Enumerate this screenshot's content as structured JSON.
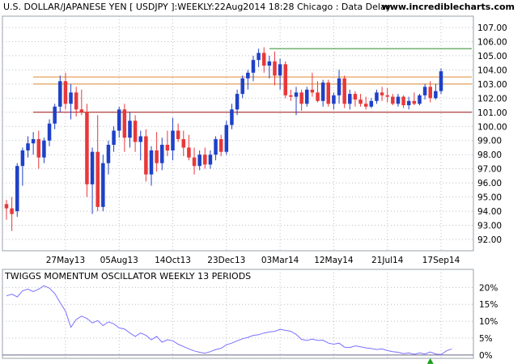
{
  "header": {
    "instrument": "U.S. DOLLAR/JAPANESE YEN [ USDJPY ]:WEEKLY:22Aug2014 18:28 Chicago : Data Delaye...",
    "site": "www.incrediblecharts.com"
  },
  "oscillator_title": "TWIGGS MOMENTUM OSCILLATOR WEEKLY 13 PERIODS",
  "colors": {
    "up": "#1f41c8",
    "down": "#e8383a",
    "grid": "#b8bec8",
    "h_red": "#a01010",
    "h_orange": "#e08a30",
    "h_green": "#2a8a2a",
    "oscillator": "#7a70ff",
    "signal": "#1aa01a"
  },
  "chart_data": [
    {
      "type": "candlestick",
      "ylim": [
        91.2,
        107.8
      ],
      "y_ticks": [
        "92.00",
        "93.00",
        "94.00",
        "95.00",
        "96.00",
        "97.00",
        "98.00",
        "99.00",
        "100.00",
        "101.00",
        "102.00",
        "103.00",
        "104.00",
        "105.00",
        "106.00",
        "107.00"
      ],
      "x_tick_labels": [
        "27May13",
        "05Aug13",
        "14Oct13",
        "23Dec13",
        "03Mar14",
        "12May14",
        "21Jul14",
        "17Sep14"
      ],
      "grid": true,
      "horizontal_lines": [
        {
          "y": 101.0,
          "color": "red"
        },
        {
          "y": 103.0,
          "color": "orange"
        },
        {
          "y": 103.5,
          "color": "orange"
        },
        {
          "y": 105.5,
          "color": "green"
        }
      ],
      "candles": [
        [
          94.5,
          94.8,
          93.4,
          94.2
        ],
        [
          94.2,
          95.0,
          92.6,
          93.8
        ],
        [
          94.0,
          97.4,
          93.6,
          97.2
        ],
        [
          97.2,
          98.5,
          95.8,
          98.3
        ],
        [
          98.3,
          99.3,
          97.8,
          98.8
        ],
        [
          98.8,
          99.6,
          98.0,
          99.1
        ],
        [
          99.1,
          99.7,
          97.0,
          97.8
        ],
        [
          97.8,
          99.2,
          97.4,
          99.0
        ],
        [
          99.0,
          100.5,
          98.6,
          100.2
        ],
        [
          100.2,
          101.6,
          99.8,
          101.4
        ],
        [
          101.4,
          103.6,
          101.0,
          103.2
        ],
        [
          103.2,
          103.8,
          101.2,
          101.6
        ],
        [
          101.6,
          103.0,
          100.5,
          102.4
        ],
        [
          102.4,
          102.8,
          100.7,
          101.2
        ],
        [
          101.2,
          102.6,
          100.8,
          101.0
        ],
        [
          101.0,
          101.6,
          95.0,
          95.9
        ],
        [
          95.9,
          98.5,
          93.8,
          98.2
        ],
        [
          98.2,
          100.8,
          94.0,
          94.3
        ],
        [
          94.3,
          98.0,
          94.0,
          97.4
        ],
        [
          97.4,
          99.0,
          96.6,
          98.7
        ],
        [
          98.7,
          100.0,
          98.2,
          99.7
        ],
        [
          99.7,
          101.4,
          99.2,
          101.2
        ],
        [
          101.2,
          101.6,
          98.2,
          99.2
        ],
        [
          99.2,
          101.0,
          98.5,
          100.4
        ],
        [
          100.4,
          100.8,
          98.2,
          98.9
        ],
        [
          98.9,
          99.7,
          97.6,
          99.3
        ],
        [
          99.3,
          99.8,
          96.1,
          96.6
        ],
        [
          96.6,
          98.6,
          95.8,
          98.3
        ],
        [
          98.3,
          99.6,
          96.8,
          97.4
        ],
        [
          97.4,
          99.2,
          96.9,
          98.7
        ],
        [
          98.7,
          99.7,
          97.9,
          98.3
        ],
        [
          98.3,
          100.6,
          97.6,
          99.7
        ],
        [
          99.7,
          100.2,
          98.9,
          99.1
        ],
        [
          99.1,
          99.7,
          97.9,
          98.5
        ],
        [
          98.5,
          99.4,
          97.6,
          97.8
        ],
        [
          97.8,
          98.5,
          96.6,
          97.2
        ],
        [
          97.2,
          98.3,
          96.9,
          98.0
        ],
        [
          98.0,
          98.5,
          97.0,
          97.3
        ],
        [
          97.3,
          98.3,
          97.0,
          98.0
        ],
        [
          98.0,
          99.3,
          97.6,
          99.1
        ],
        [
          99.1,
          99.4,
          97.9,
          98.2
        ],
        [
          98.2,
          100.4,
          98.0,
          100.1
        ],
        [
          100.1,
          101.6,
          99.8,
          101.2
        ],
        [
          101.2,
          102.6,
          100.8,
          102.3
        ],
        [
          102.3,
          103.6,
          102.0,
          103.4
        ],
        [
          103.4,
          104.0,
          102.6,
          103.8
        ],
        [
          103.8,
          105.0,
          103.2,
          104.7
        ],
        [
          104.7,
          105.5,
          104.2,
          105.2
        ],
        [
          105.2,
          105.6,
          103.8,
          104.3
        ],
        [
          104.3,
          105.0,
          103.4,
          104.6
        ],
        [
          104.6,
          105.3,
          102.9,
          103.6
        ],
        [
          103.6,
          104.8,
          102.6,
          104.4
        ],
        [
          104.4,
          104.6,
          102.0,
          102.2
        ],
        [
          102.2,
          102.6,
          101.8,
          102.1
        ],
        [
          102.1,
          102.8,
          100.8,
          102.4
        ],
        [
          102.4,
          102.6,
          101.1,
          101.6
        ],
        [
          101.6,
          102.8,
          101.4,
          102.6
        ],
        [
          102.6,
          103.8,
          102.1,
          102.4
        ],
        [
          102.4,
          103.2,
          101.7,
          101.8
        ],
        [
          101.8,
          103.3,
          101.4,
          103.1
        ],
        [
          103.1,
          103.3,
          101.4,
          101.6
        ],
        [
          101.6,
          102.4,
          101.2,
          102.2
        ],
        [
          102.2,
          104.0,
          101.6,
          103.4
        ],
        [
          103.4,
          103.6,
          101.3,
          101.6
        ],
        [
          101.6,
          102.6,
          101.2,
          102.3
        ],
        [
          102.3,
          102.5,
          101.4,
          101.9
        ],
        [
          101.9,
          102.3,
          101.4,
          101.6
        ],
        [
          101.6,
          102.1,
          101.2,
          101.4
        ],
        [
          101.4,
          102.0,
          101.3,
          101.8
        ],
        [
          101.8,
          102.6,
          101.6,
          102.4
        ],
        [
          102.4,
          102.8,
          101.8,
          102.2
        ],
        [
          102.2,
          102.7,
          101.7,
          102.1
        ],
        [
          102.1,
          102.3,
          101.5,
          101.6
        ],
        [
          101.6,
          102.3,
          101.4,
          102.1
        ],
        [
          102.1,
          102.2,
          101.3,
          101.5
        ],
        [
          101.5,
          102.1,
          101.2,
          101.8
        ],
        [
          101.8,
          102.4,
          101.5,
          101.6
        ],
        [
          101.6,
          102.3,
          101.5,
          102.2
        ],
        [
          102.2,
          103.0,
          101.9,
          102.8
        ],
        [
          102.8,
          103.2,
          101.7,
          102.0
        ],
        [
          102.0,
          103.0,
          101.9,
          102.5
        ],
        [
          102.5,
          104.1,
          102.3,
          103.9
        ]
      ]
    },
    {
      "type": "line",
      "title": "TWIGGS MOMENTUM OSCILLATOR WEEKLY 13 PERIODS",
      "ylim": [
        -1,
        22
      ],
      "y_ticks": [
        "20%",
        "15%",
        "10%",
        "5%",
        "0%"
      ],
      "values": [
        17.5,
        18.0,
        17.2,
        19.0,
        19.5,
        18.8,
        19.5,
        20.5,
        19.8,
        18.2,
        15.5,
        13.0,
        8.2,
        10.5,
        11.5,
        10.8,
        9.5,
        10.2,
        8.7,
        9.8,
        9.2,
        8.0,
        7.7,
        6.5,
        5.5,
        6.5,
        5.8,
        4.5,
        5.5,
        3.8,
        4.5,
        4.2,
        3.2,
        2.5,
        1.8,
        1.2,
        0.8,
        0.5,
        1.0,
        1.6,
        2.0,
        3.0,
        3.5,
        4.2,
        4.8,
        5.2,
        5.8,
        6.0,
        6.5,
        6.8,
        7.0,
        7.6,
        7.3,
        7.0,
        6.1,
        4.6,
        4.3,
        4.7,
        4.3,
        4.4,
        3.5,
        3.2,
        3.5,
        2.3,
        2.2,
        2.7,
        2.4,
        2.1,
        1.9,
        1.6,
        1.8,
        1.3,
        1.0,
        0.8,
        0.4,
        0.6,
        0.2,
        0.6,
        0.3,
        0.9,
        0.3,
        0.1,
        1.2,
        1.8
      ]
    }
  ]
}
